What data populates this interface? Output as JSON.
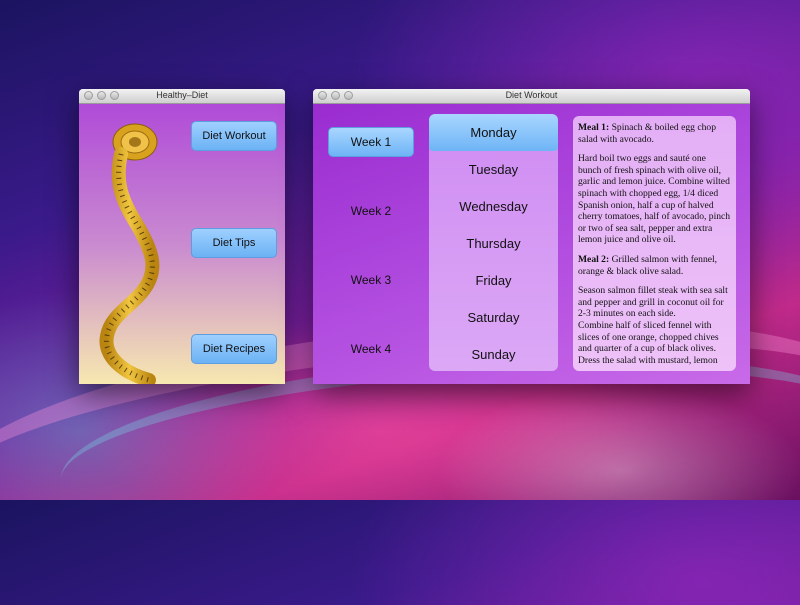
{
  "windows": {
    "main": {
      "title": "Healthy–Diet",
      "buttons": {
        "workout": "Diet Workout",
        "tips": "Diet Tips",
        "recipes": "Diet Recipes"
      }
    },
    "workout": {
      "title": "Diet Workout",
      "weeks": [
        "Week 1",
        "Week 2",
        "Week 3",
        "Week 4"
      ],
      "selected_week": "Week 1",
      "days": [
        "Monday",
        "Tuesday",
        "Wednesday",
        "Thursday",
        "Friday",
        "Saturday",
        "Sunday"
      ],
      "selected_day": "Monday",
      "meal1": {
        "label": "Meal 1:",
        "title": " Spinach & boiled egg chop salad with avocado.",
        "body": "Hard boil two eggs and sauté one bunch of fresh spinach with olive oil, garlic and lemon juice. Combine wilted spinach with chopped egg, 1/4 diced Spanish onion, half a cup of halved cherry tomatoes, half of avocado, pinch or two of sea salt, pepper and extra lemon juice and olive oil."
      },
      "meal2": {
        "label": "Meal 2:",
        "title": " Grilled salmon with fennel, orange & black olive salad.",
        "body1": "Season salmon fillet steak with sea salt and pepper and grill in coconut oil for 2-3 minutes on each side.",
        "body2": "Combine half of sliced fennel with slices of one orange, chopped chives and quarter of a cup of black olives. Dress the salad with mustard, lemon"
      }
    }
  },
  "colors": {
    "button_blue": "#6bb2f4",
    "tape_yellow": "#e0b020"
  },
  "icons": {
    "illustration": "measuring-tape-icon"
  }
}
